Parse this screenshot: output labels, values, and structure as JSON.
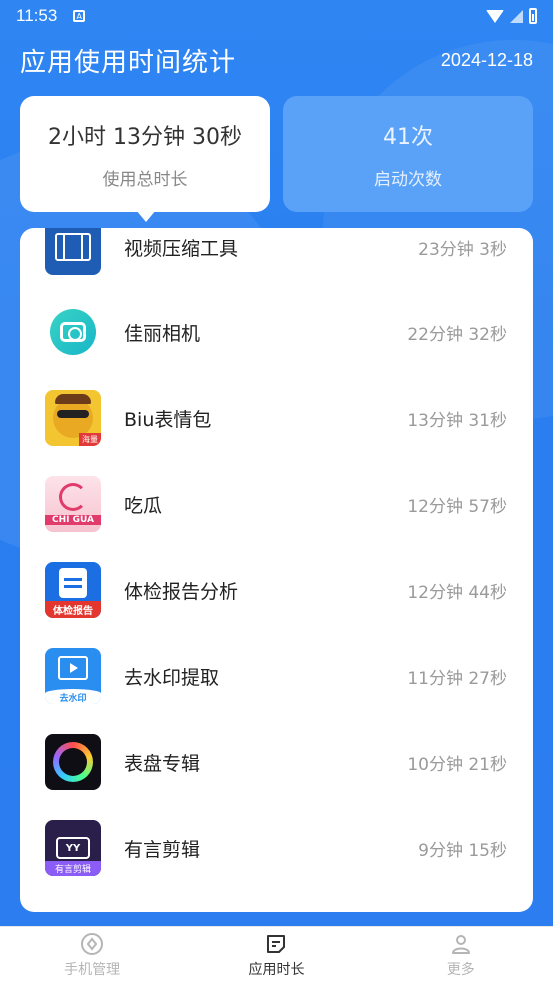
{
  "status_bar": {
    "time": "11:53",
    "sim_icon": "A",
    "icons": [
      "wifi-icon",
      "signal-icon",
      "battery-icon"
    ]
  },
  "header": {
    "title": "应用使用时间统计",
    "date": "2024-12-18"
  },
  "stats": {
    "total_duration": {
      "value": "2小时 13分钟 30秒",
      "label": "使用总时长"
    },
    "launch_count": {
      "value": "41次",
      "label": "启动次数"
    }
  },
  "apps": [
    {
      "name": "视频压缩工具",
      "time": "23分钟 3秒",
      "icon": "video-compress-icon"
    },
    {
      "name": "佳丽相机",
      "time": "22分钟 32秒",
      "icon": "camera-icon"
    },
    {
      "name": "Biu表情包",
      "time": "13分钟 31秒",
      "icon": "emoji-face-icon",
      "tag": "海量"
    },
    {
      "name": "吃瓜",
      "time": "12分钟 57秒",
      "icon": "chigua-icon",
      "tag": "CHI GUA"
    },
    {
      "name": "体检报告分析",
      "time": "12分钟 44秒",
      "icon": "report-icon",
      "tag": "体检报告"
    },
    {
      "name": "去水印提取",
      "time": "11分钟 27秒",
      "icon": "watermark-icon",
      "tag": "去水印"
    },
    {
      "name": "表盘专辑",
      "time": "10分钟 21秒",
      "icon": "dial-icon"
    },
    {
      "name": "有言剪辑",
      "time": "9分钟 15秒",
      "icon": "video-edit-icon",
      "tag": "有言剪辑",
      "badge": "YY"
    }
  ],
  "bottom_nav": [
    {
      "label": "手机管理",
      "icon": "compass-icon",
      "active": false
    },
    {
      "label": "应用时长",
      "icon": "note-icon",
      "active": true
    },
    {
      "label": "更多",
      "icon": "person-icon",
      "active": false
    }
  ],
  "colors": {
    "primary_blue": "#2b7ff1",
    "inactive_card": "#5aa2f7",
    "text_dark": "#222222",
    "text_muted": "#9a9a9a"
  }
}
